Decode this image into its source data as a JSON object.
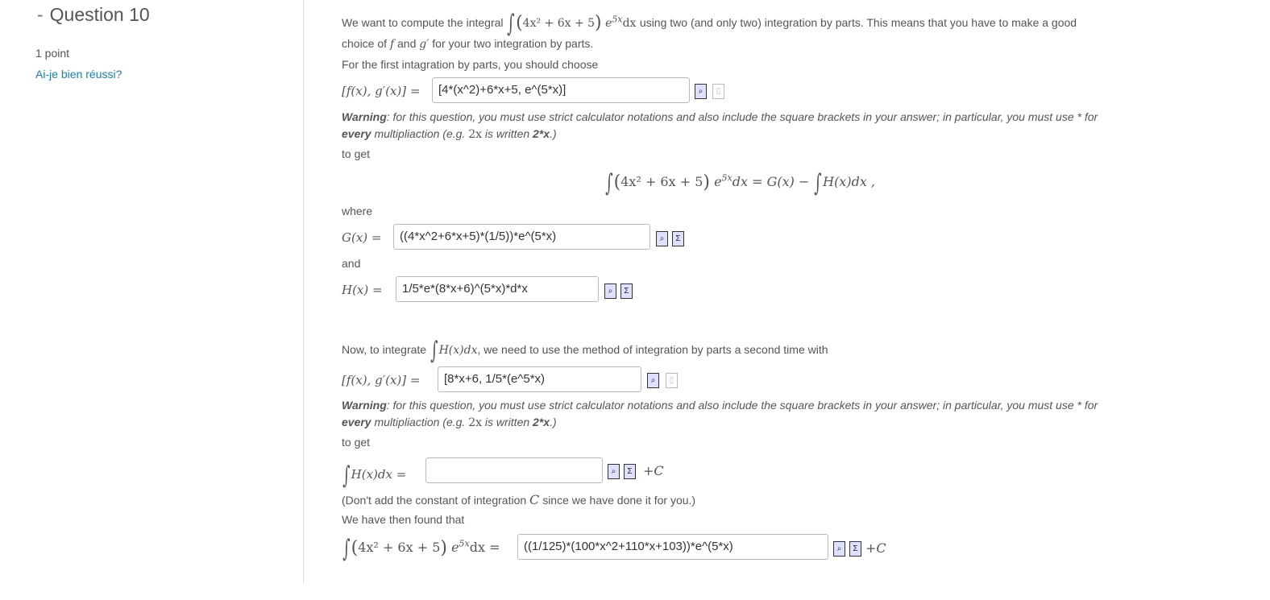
{
  "sidebar": {
    "dash": "-",
    "question_title": "Question 10",
    "points": "1 point",
    "check_link": "Ai-je bien réussi?"
  },
  "question": {
    "intro_before": "We want to compute the integral",
    "intro_after": "using two (and only two) integration by parts. This means that you have to make a good",
    "intro_line2_a": "choice of",
    "intro_line2_f": "f",
    "intro_line2_and": "and",
    "intro_line2_g": "g′",
    "intro_line2_b": "for your two integration by parts.",
    "first_choose": "For the first intagration by parts, you should choose",
    "fg_label": "[f(x), g′(x)] =",
    "answer1": "[4*(x^2)+6*x+5, e^(5*x)]",
    "warning_bold1": "Warning",
    "warning_text1": ": for this question, you must use strict calculator notations and also include the square brackets in your answer; in particular, you must use * for",
    "warning_bold2": "every",
    "warning_text2": "multipliaction (e.g.",
    "warning_math": "2x",
    "warning_text3": "is written",
    "warning_bold3": "2*x",
    "warning_text4": ".)",
    "to_get": "to get",
    "display_rhs": "dx = G(x) − ",
    "display_rhs2": "H(x)dx ,",
    "where": "where",
    "g_label": "G(x) =",
    "answer_G": "((4*x^2+6*x+5)*(1/5))*e^(5*x)",
    "and": "and",
    "h_label": "H(x) =",
    "answer_H": "1/5*e*(8*x+6)^(5*x)*d*x",
    "now_before": "Now, to integrate",
    "now_math": "H(x)dx",
    "now_after": ", we need to use the method of integration by parts a second time with",
    "answer2": "[8*x+6, 1/5*(e^5*x)",
    "int_h_label": "H(x)dx =",
    "answer_int_h": "",
    "plus_c": "+C",
    "dont_add": "(Don't add the constant of integration",
    "dont_add_c": "C",
    "dont_add_after": "since we have done it for you.)",
    "found": "We have then found that",
    "answer_final": "((1/125)*(100*x^2+110*x+103))*e^(5*x)",
    "integrand_poly": "4x² + 6x + 5",
    "integrand_exp": "e",
    "integrand_exp_power": "5x",
    "integrand_dx": "dx",
    "integrand_eq": "dx ="
  },
  "icons": {
    "preview": "preview-icon",
    "formula": "sigma-icon",
    "disabled": "blank-doc-icon"
  }
}
